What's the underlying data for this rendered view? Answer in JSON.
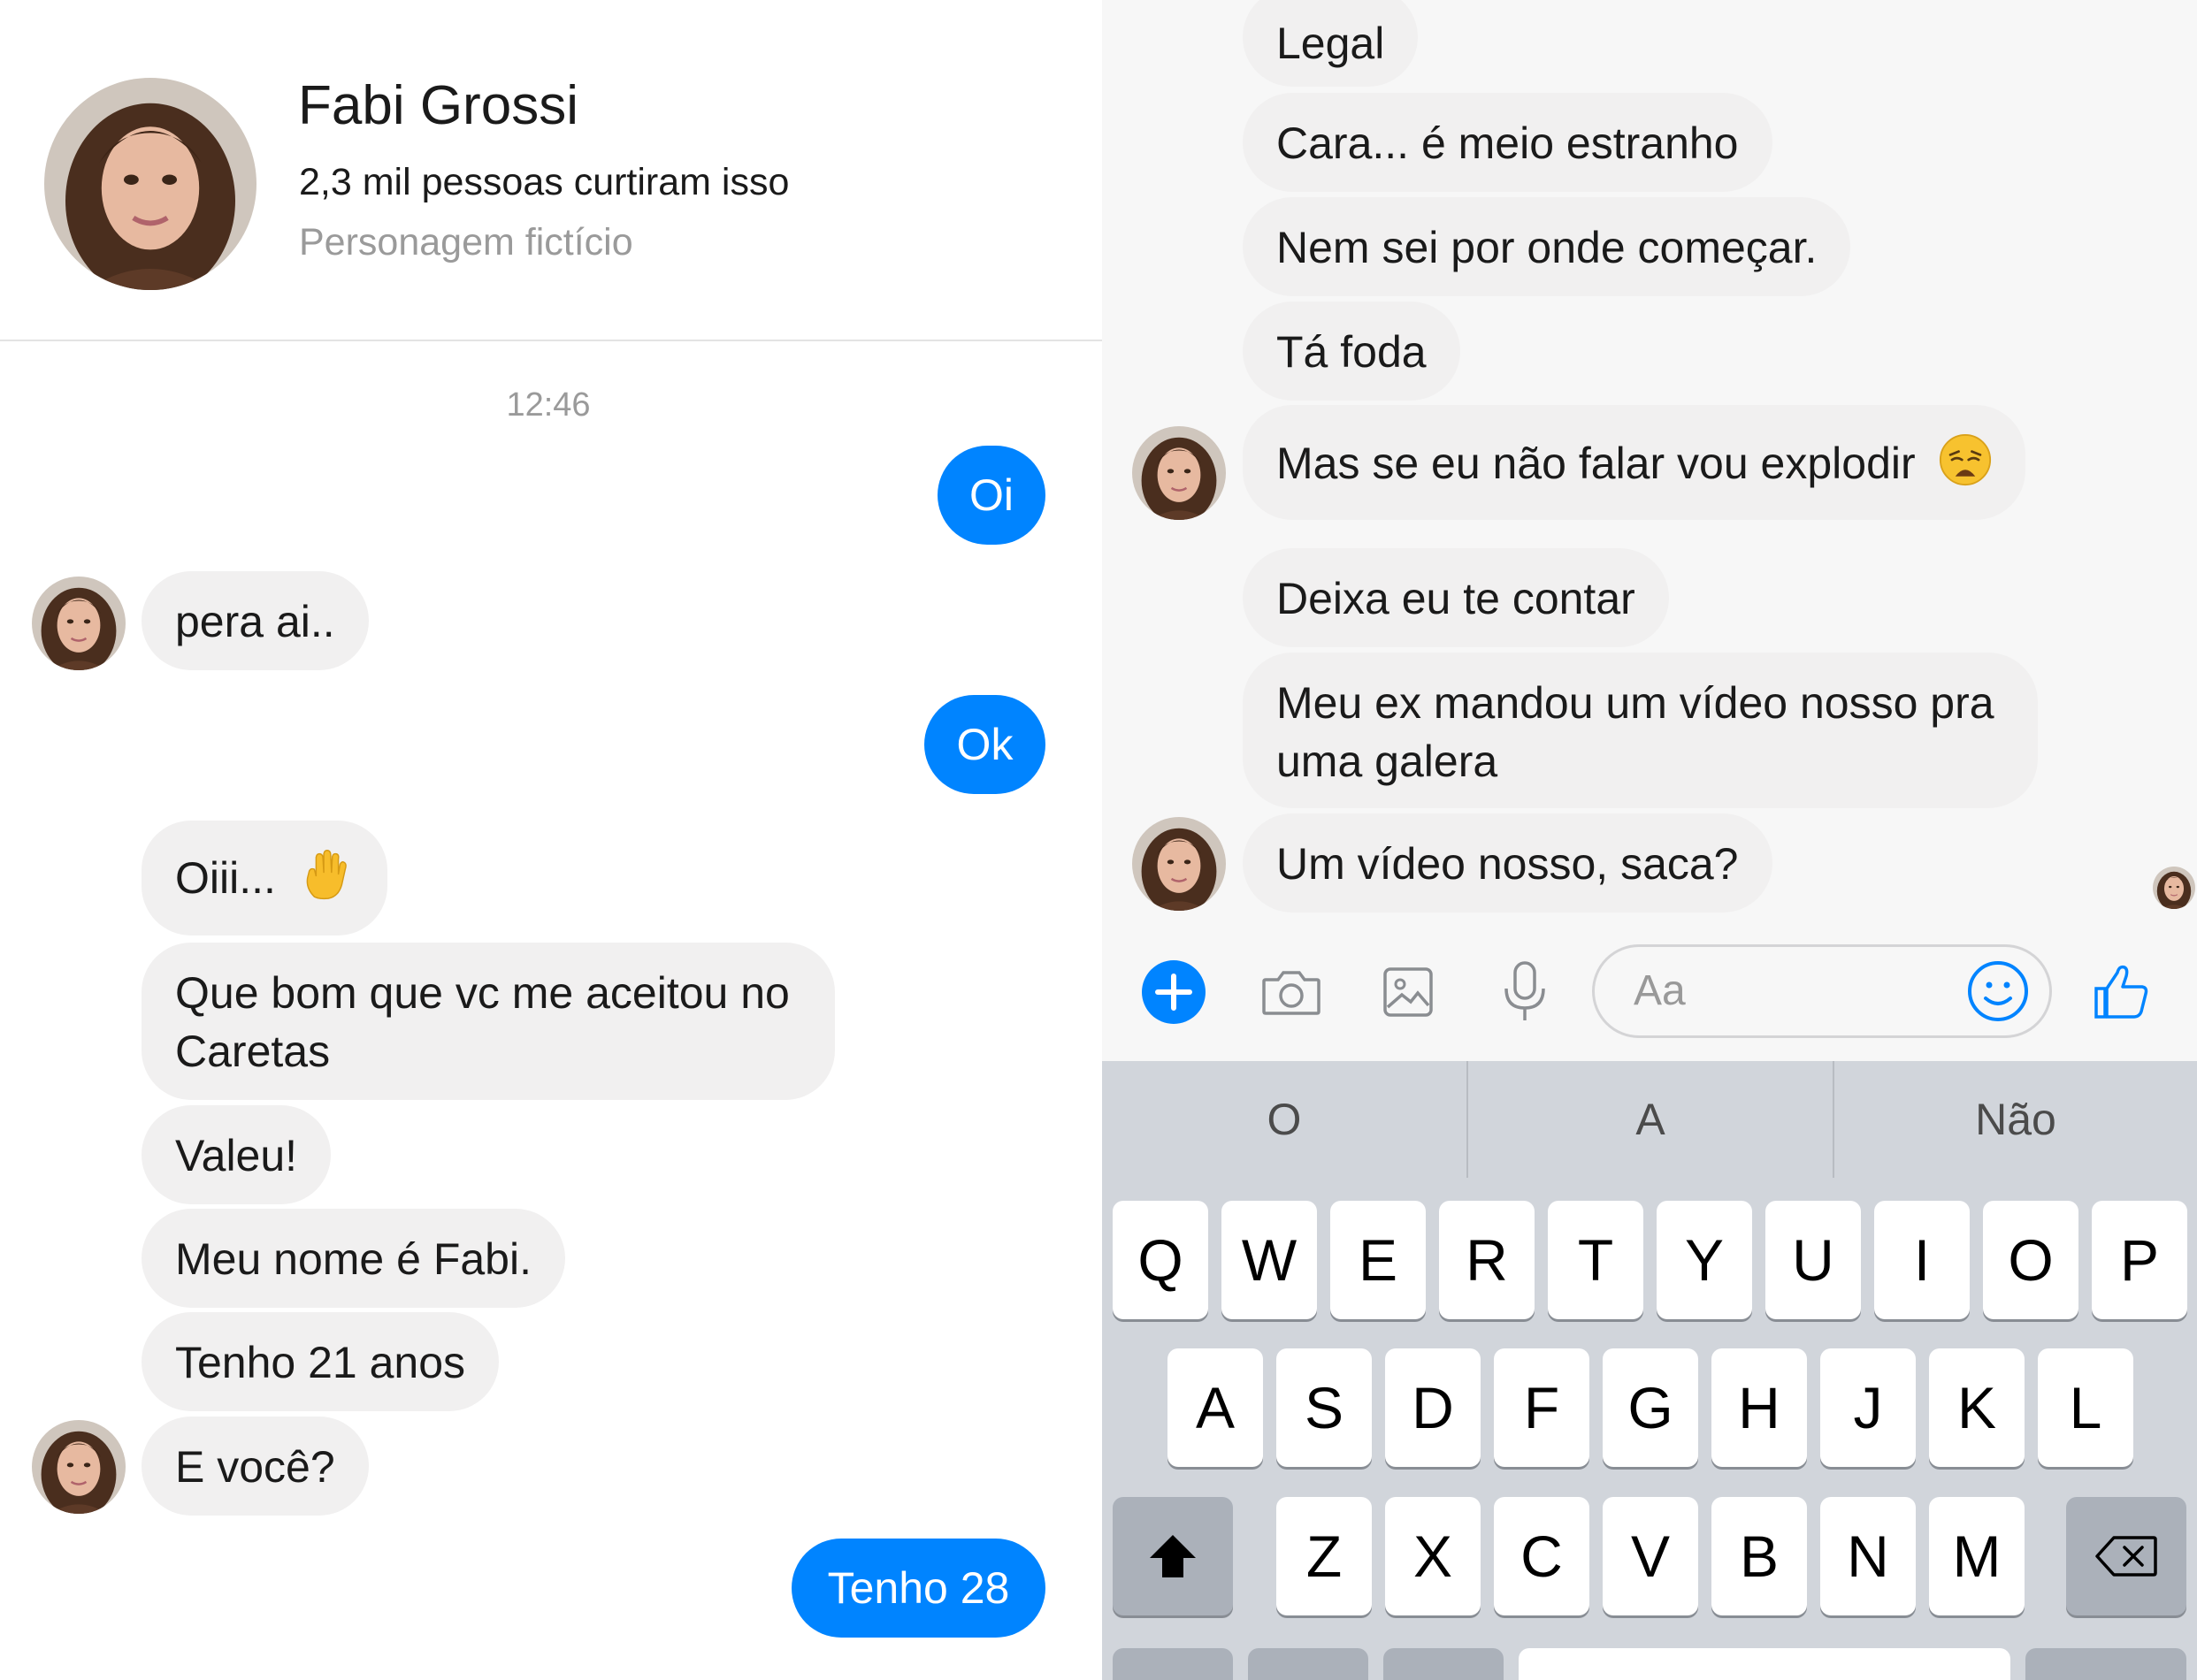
{
  "profile": {
    "name": "Fabi Grossi",
    "likes": "2,3 mil pessoas curtiram isso",
    "category": "Personagem fictício"
  },
  "conversation": {
    "timestamp": "12:46",
    "left_messages": [
      {
        "from": "me",
        "text": "Oi"
      },
      {
        "from": "them",
        "text": "pera ai.."
      },
      {
        "from": "me",
        "text": "Ok"
      },
      {
        "from": "them",
        "text": "Oiii..."
      },
      {
        "from": "them",
        "text": "Que bom que vc me aceitou no Caretas"
      },
      {
        "from": "them",
        "text": "Valeu!"
      },
      {
        "from": "them",
        "text": "Meu nome é Fabi."
      },
      {
        "from": "them",
        "text": "Tenho 21 anos"
      },
      {
        "from": "them",
        "text": "E você?"
      },
      {
        "from": "me",
        "text": "Tenho 28"
      }
    ],
    "right_messages": [
      {
        "from": "them",
        "text": "Legal"
      },
      {
        "from": "them",
        "text": "Cara... é meio estranho"
      },
      {
        "from": "them",
        "text": "Nem sei por onde começar."
      },
      {
        "from": "them",
        "text": "Tá foda"
      },
      {
        "from": "them",
        "text": "Mas se eu não falar vou explodir"
      },
      {
        "from": "them",
        "text": "Deixa eu te contar"
      },
      {
        "from": "them",
        "text": "Meu ex mandou um vídeo nosso pra uma galera"
      },
      {
        "from": "them",
        "text": "Um vídeo nosso, saca?"
      }
    ]
  },
  "composer": {
    "placeholder": "Aa",
    "tools": [
      "plus-icon",
      "camera-icon",
      "image-icon",
      "microphone-icon",
      "emoji-icon",
      "thumbs-up-icon"
    ]
  },
  "keyboard": {
    "predictions": [
      "O",
      "A",
      "Não"
    ],
    "row1": [
      "Q",
      "W",
      "E",
      "R",
      "T",
      "Y",
      "U",
      "I",
      "O",
      "P"
    ],
    "row2": [
      "A",
      "S",
      "D",
      "F",
      "G",
      "H",
      "J",
      "K",
      "L"
    ],
    "row3": [
      "Z",
      "X",
      "C",
      "V",
      "B",
      "N",
      "M"
    ]
  },
  "colors": {
    "accent": "#0084ff",
    "incoming_bubble": "#f1f0f0",
    "keyboard_bg": "#d1d5db"
  }
}
